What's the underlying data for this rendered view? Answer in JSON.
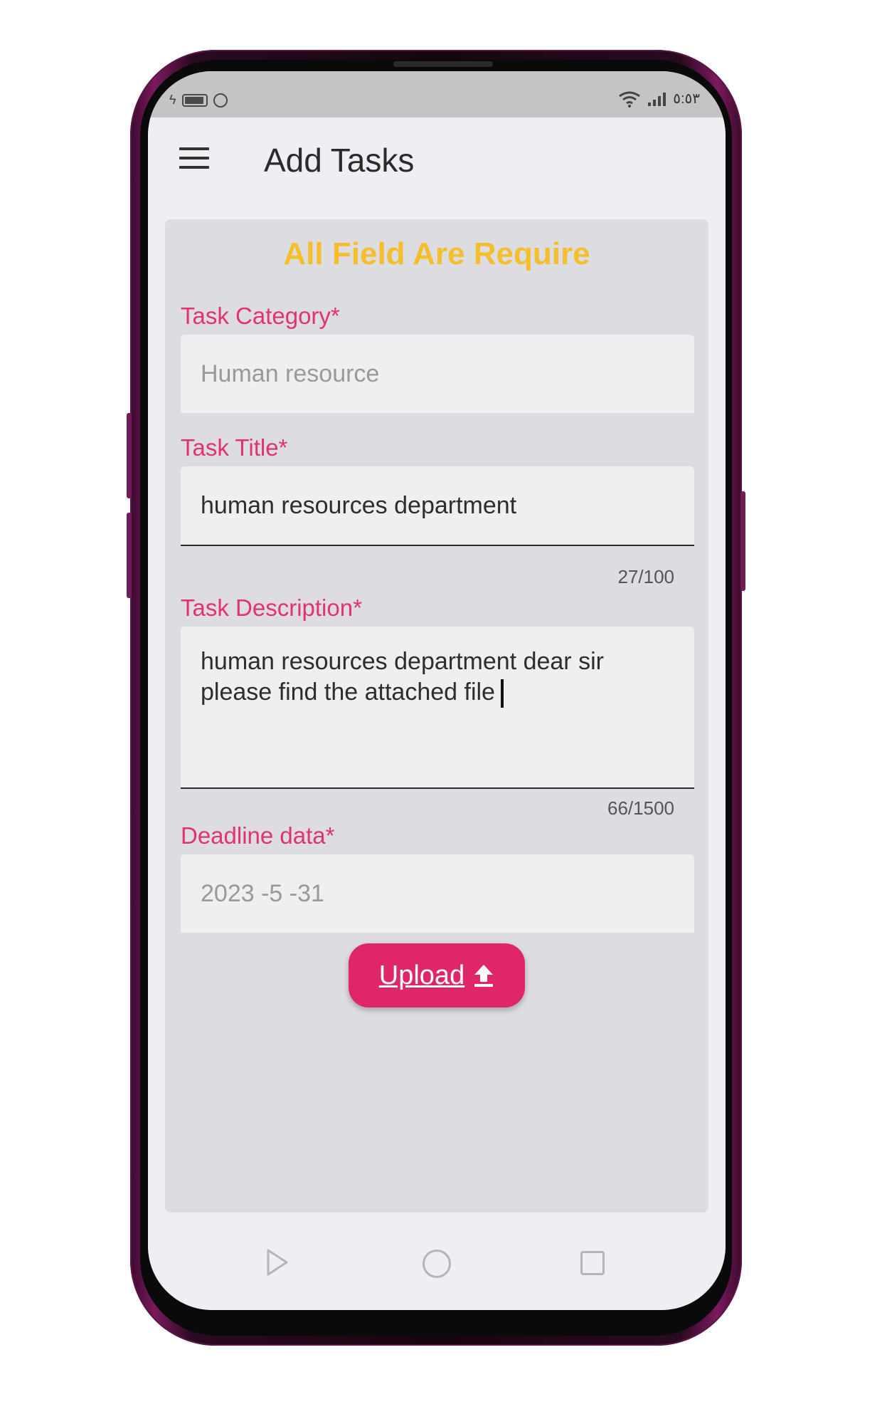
{
  "status_bar": {
    "time": "٥:٥٣"
  },
  "app_bar": {
    "title": "Add Tasks",
    "menu_icon": "hamburger-menu-icon"
  },
  "form": {
    "notice": "All Field Are Require",
    "category": {
      "label": "Task Category*",
      "placeholder": "Human resource"
    },
    "title": {
      "label": "Task Title*",
      "value": "human resources department",
      "counter": "27/100"
    },
    "description": {
      "label": "Task Description*",
      "value": "human resources department dear sir\nplease find the attached file",
      "counter": "66/1500"
    },
    "deadline": {
      "label": "Deadline data*",
      "value": "2023 -5 -31"
    },
    "upload": {
      "label": "Upload",
      "icon": "upload-arrow-icon"
    }
  },
  "colors": {
    "accent": "#e0266a",
    "label": "#e0336f",
    "notice": "#f4be2c",
    "card": "#dddde1"
  },
  "nav": {
    "back_icon": "triangle-back-icon",
    "home_icon": "circle-home-icon",
    "recent_icon": "square-recent-icon"
  }
}
